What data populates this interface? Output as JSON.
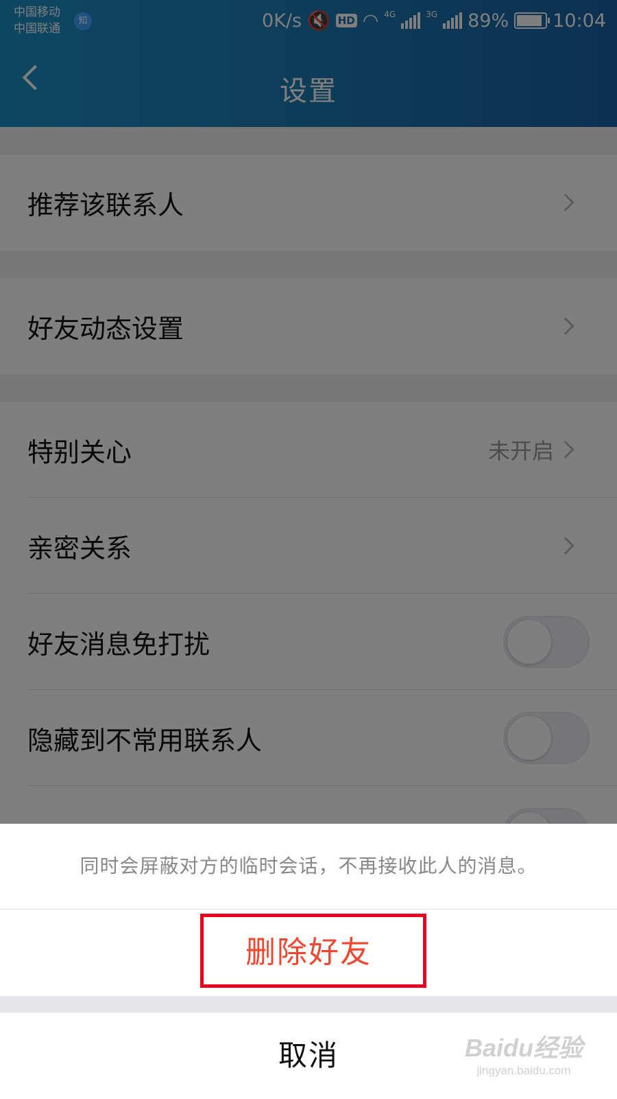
{
  "status_bar": {
    "carrier1": "中国移动",
    "carrier2": "中国联通",
    "carrier_badge": "知",
    "speed": "0K/s",
    "hd": "HD",
    "net1": "4G",
    "net2": "3G",
    "battery": "89%",
    "time": "10:04"
  },
  "header": {
    "title": "设置"
  },
  "rows": [
    {
      "label": "推荐该联系人"
    },
    {
      "label": "好友动态设置"
    },
    {
      "label": "特别关心",
      "value": "未开启"
    },
    {
      "label": "亲密关系"
    },
    {
      "label": "好友消息免打扰",
      "toggle": false
    },
    {
      "label": "隐藏到不常用联系人",
      "toggle": false
    }
  ],
  "sheet": {
    "description": "同时会屏蔽对方的临时会话，不再接收此人的消息。",
    "delete_label": "删除好友",
    "cancel_label": "取消"
  },
  "watermark": {
    "main": "Baidu经验",
    "sub": "jingyan.baidu.com"
  },
  "colors": {
    "header": "#1a78b0",
    "danger": "#f0462f",
    "highlight": "#e8001f"
  }
}
